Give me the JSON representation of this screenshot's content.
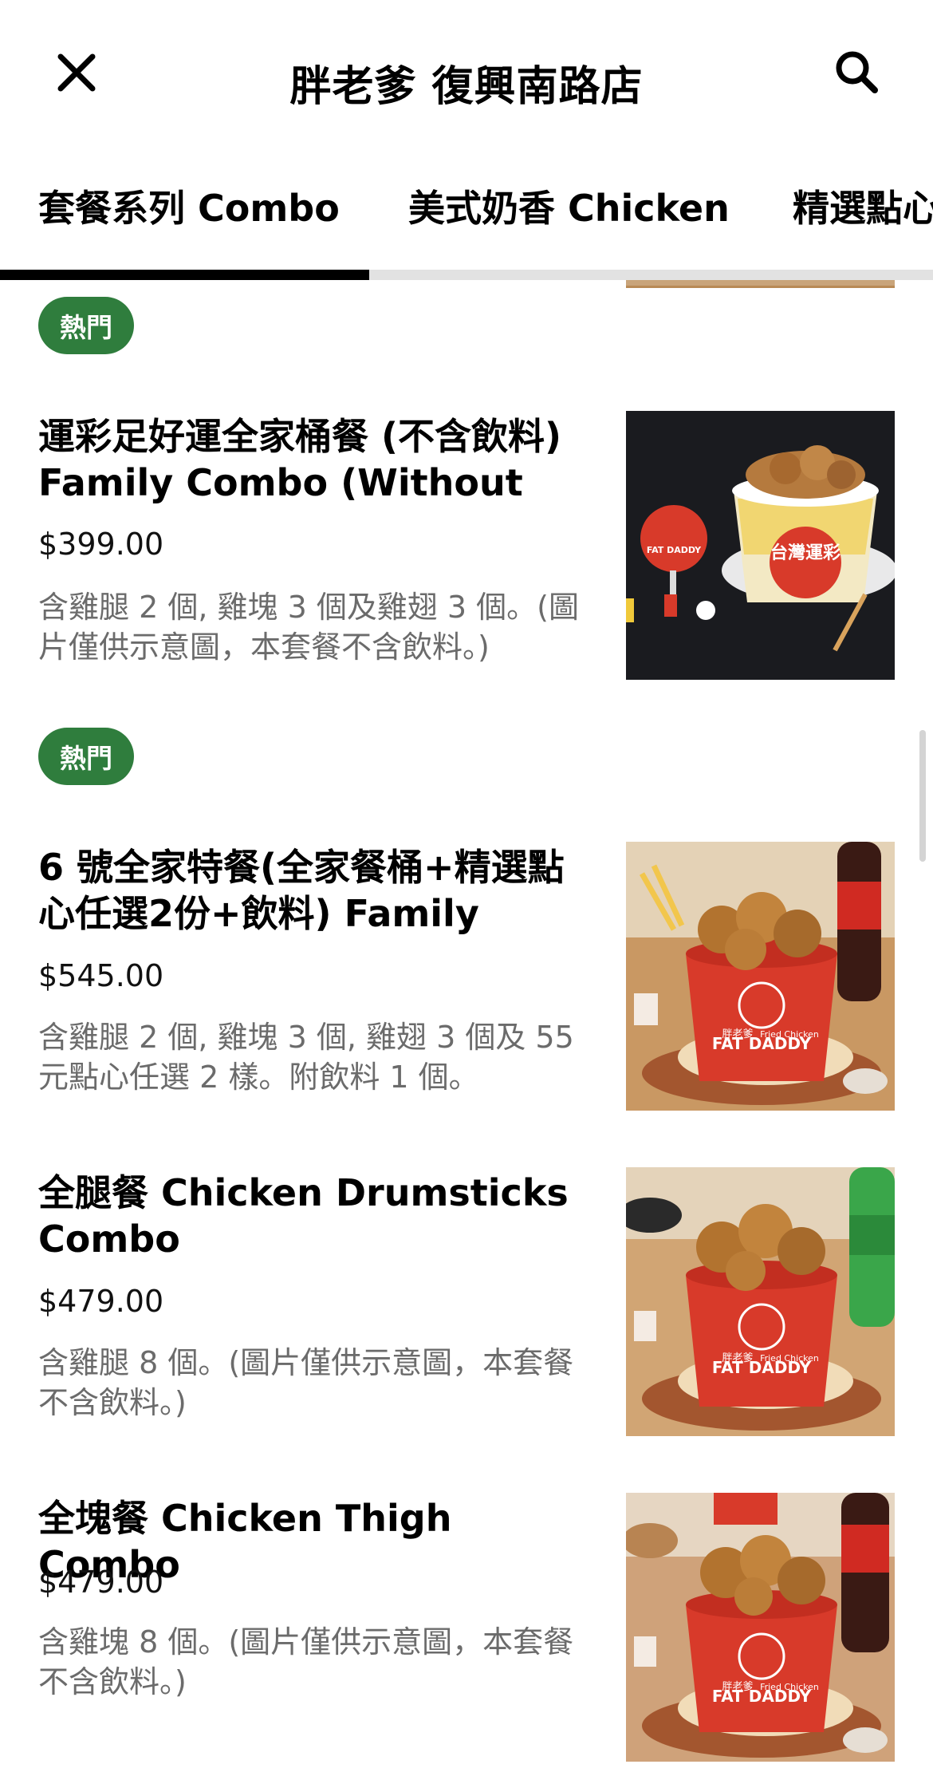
{
  "header": {
    "title": "胖老爹 復興南路店",
    "close_icon": "close-icon",
    "search_icon": "search-icon"
  },
  "tabs": [
    {
      "label": "套餐系列 Combo",
      "active": true
    },
    {
      "label": "美式奶香 Chicken",
      "active": false
    },
    {
      "label": "精選點心",
      "active": false
    }
  ],
  "colors": {
    "badge_green": "#2f7d3d",
    "tab_indicator": "#000000",
    "bucket_red": "#d83a2a"
  },
  "badges": {
    "popular": "熱門"
  },
  "items": [
    {
      "title": "運彩足好運全家桶餐 (不含飲料) Family Combo (Without",
      "price": "$399.00",
      "description": "含雞腿 2 個, 雞塊 3 個及雞翅 3 個。(圖片僅供示意圖，本套餐不含飲料。)",
      "image_text_badge": "台灣運彩",
      "image_logo": "FAT DADDY"
    },
    {
      "title": "6 號全家特餐(全家餐桶+精選點心任選2份+飲料) Family",
      "price": "$545.00",
      "description": "含雞腿 2 個, 雞塊 3 個, 雞翅 3 個及 55 元點心任選 2 樣。附飲料 1 個。",
      "image_logo": "FAT DADDY",
      "image_logo_sub": "Fried Chicken",
      "image_brand": "胖老爹"
    },
    {
      "title": "全腿餐 Chicken Drumsticks Combo",
      "price": "$479.00",
      "description": "含雞腿 8 個。(圖片僅供示意圖，本套餐不含飲料。)",
      "image_logo": "FAT DADDY",
      "image_logo_sub": "Fried Chicken",
      "image_brand": "胖老爹"
    },
    {
      "title": "全塊餐 Chicken Thigh Combo",
      "price": "$479.00",
      "description": "含雞塊 8 個。(圖片僅供示意圖，本套餐不含飲料。)",
      "image_logo": "FAT DADDY",
      "image_logo_sub": "Fried Chicken",
      "image_brand": "胖老爹"
    }
  ]
}
